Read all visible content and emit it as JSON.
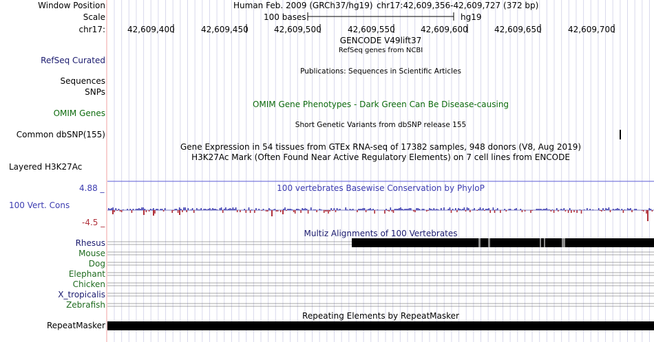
{
  "header": {
    "window_position_label": "Window Position",
    "scale_label": "Scale",
    "chrom_label": "chr17:",
    "assembly_text": "Human Feb. 2009 (GRCh37/hg19)",
    "position_text": "chr17:42,609,356-42,609,727 (372 bp)",
    "scale_bar_label": "100 bases",
    "scale_db": "hg19",
    "ruler_ticks": [
      "42,609,400",
      "42,609,450",
      "42,609,500",
      "42,609,550",
      "42,609,600",
      "42,609,650",
      "42,609,700"
    ]
  },
  "tracks": {
    "gencode_title": "GENCODE V49lift37",
    "refseq_title": "RefSeq genes from NCBI",
    "refseq_label": "RefSeq Curated",
    "publications_title": "Publications: Sequences in Scientific Articles",
    "sequences_label": "Sequences",
    "snps_label": "SNPs",
    "omim_label": "OMIM Genes",
    "omim_title": "OMIM Gene Phenotypes - Dark Green Can Be Disease-causing",
    "dbsnp_title": "Short Genetic Variants from dbSNP release 155",
    "dbsnp_label": "Common dbSNP(155)",
    "gtex_title": "Gene Expression in 54 tissues from GTEx RNA-seq of 17382 samples, 948 donors (V8, Aug 2019)",
    "h3k27ac_title": "H3K27Ac Mark (Often Found Near Active Regulatory Elements) on 7 cell lines from ENCODE",
    "h3k27ac_label": "Layered H3K27Ac",
    "cons_max": "4.88 _",
    "cons_title": "100 vertebrates Basewise Conservation by PhyloP",
    "cons_label": "100 Vert. Cons",
    "cons_min": "-4.5 _",
    "multiz_title": "Multiz Alignments of 100 Vertebrates",
    "species": [
      "Rhesus",
      "Mouse",
      "Dog",
      "Elephant",
      "Chicken",
      "X_tropicalis",
      "Zebrafish"
    ],
    "repeat_title": "Repeating Elements by RepeatMasker",
    "repeat_label": "RepeatMasker"
  },
  "colors": {
    "refseq_label": "#1a1a6e",
    "omim": "#0d6b0d",
    "conservation": "#3b3bb0",
    "conservation_neg": "#b0303a",
    "species_primate": "#1a1a6e",
    "species_other": "#1f6b1f",
    "grid": "#d8d8ec",
    "guide_left": "#f2a0a0"
  }
}
